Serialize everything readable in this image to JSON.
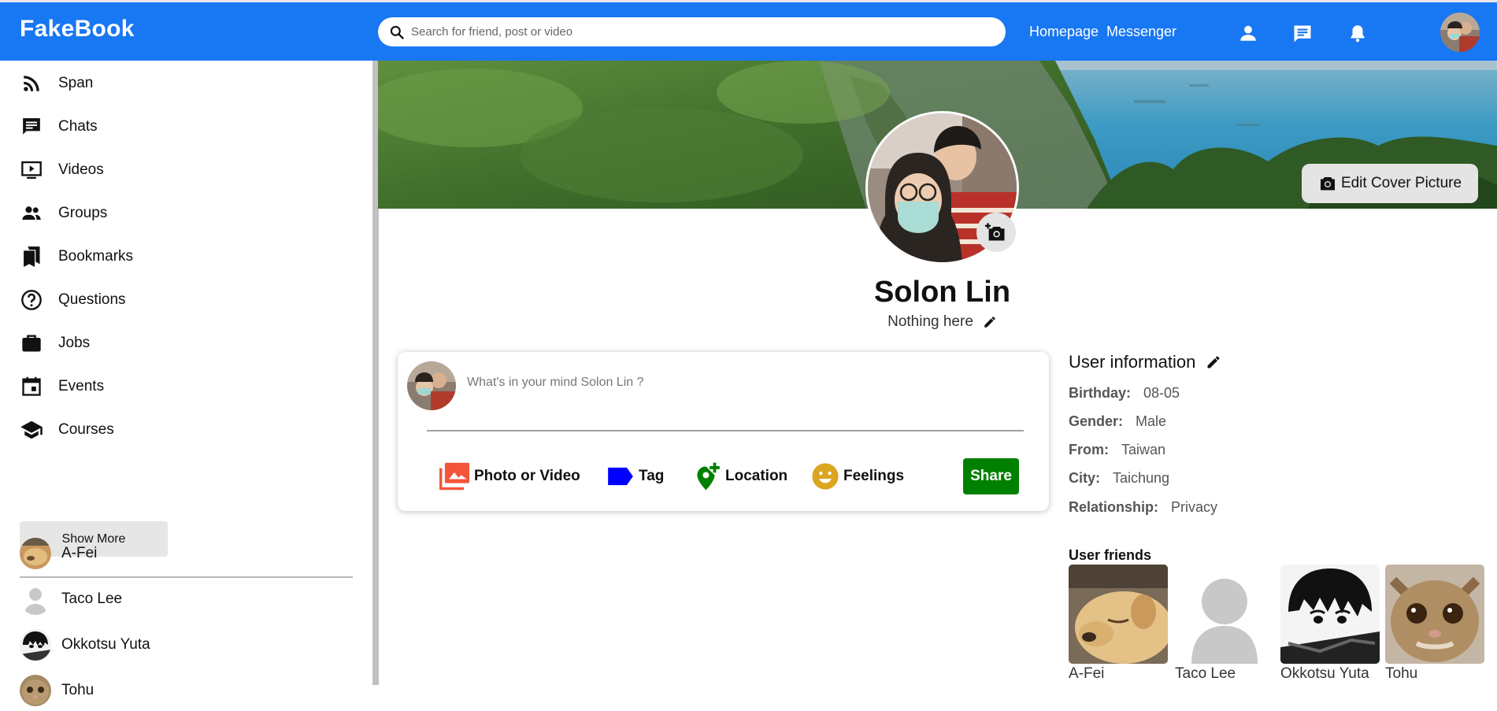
{
  "app": {
    "title": "FakeBook"
  },
  "search": {
    "placeholder": "Search for friend, post or video"
  },
  "nav": {
    "homepage": "Homepage",
    "messenger": "Messenger"
  },
  "sidebar": {
    "items": [
      {
        "label": "Span",
        "icon": "rss-icon"
      },
      {
        "label": "Chats",
        "icon": "chat-icon"
      },
      {
        "label": "Videos",
        "icon": "video-icon"
      },
      {
        "label": "Groups",
        "icon": "group-icon"
      },
      {
        "label": "Bookmarks",
        "icon": "bookmark-icon"
      },
      {
        "label": "Questions",
        "icon": "question-icon"
      },
      {
        "label": "Jobs",
        "icon": "briefcase-icon"
      },
      {
        "label": "Events",
        "icon": "calendar-icon"
      },
      {
        "label": "Courses",
        "icon": "graduation-cap-icon"
      }
    ],
    "show_more": "Show More",
    "friends": [
      {
        "name": "A-Fei"
      },
      {
        "name": "Taco Lee"
      },
      {
        "name": "Okkotsu Yuta"
      },
      {
        "name": "Tohu"
      }
    ]
  },
  "profile": {
    "edit_cover": "Edit Cover Picture",
    "name": "Solon Lin",
    "bio": "Nothing here"
  },
  "post": {
    "placeholder": "What's in your mind Solon Lin ?",
    "actions": {
      "photo": "Photo or Video",
      "tag": "Tag",
      "location": "Location",
      "feelings": "Feelings"
    },
    "share": "Share"
  },
  "user_info": {
    "title": "User information",
    "rows": [
      {
        "key": "Birthday:",
        "value": "08-05"
      },
      {
        "key": "Gender:",
        "value": "Male"
      },
      {
        "key": "From:",
        "value": "Taiwan"
      },
      {
        "key": "City:",
        "value": "Taichung"
      },
      {
        "key": "Relationship:",
        "value": "Privacy"
      }
    ]
  },
  "user_friends": {
    "title": "User friends",
    "list": [
      {
        "name": "A-Fei"
      },
      {
        "name": "Taco Lee"
      },
      {
        "name": "Okkotsu Yuta"
      },
      {
        "name": "Tohu"
      }
    ]
  },
  "colors": {
    "brand": "#1877f2",
    "share": "#008000",
    "photo_icon": "#f3553a",
    "tag_icon": "#0000ff",
    "location_icon": "#008000",
    "feelings_icon": "#daa520"
  }
}
